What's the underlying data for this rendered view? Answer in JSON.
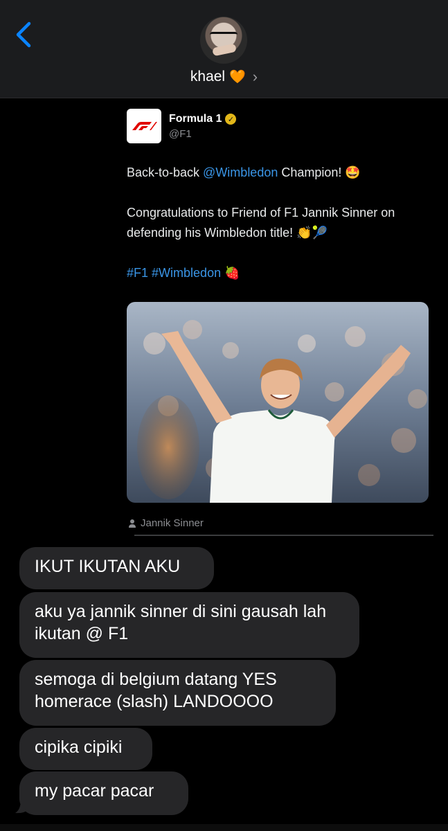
{
  "header": {
    "contact_name": "khael",
    "heart": "🧡",
    "chevron": "›"
  },
  "tweet": {
    "name": "Formula 1",
    "handle": "@F1",
    "line1_prefix": "Back-to-back ",
    "line1_link": "@Wimbledon",
    "line1_suffix": " Champion! 🤩",
    "line2": "Congratulations to Friend of F1 Jannik Sinner on defending his Wimbledon title! 👏🎾",
    "hashtag1": "#F1",
    "hashtag2": "#Wimbledon",
    "hashtag_emoji": "🍓",
    "photo_tag": "Jannik Sinner"
  },
  "messages": [
    "IKUT IKUTAN AKU",
    "aku ya jannik sinner di sini gausah lah ikutan @ F1",
    "semoga di belgium datang YES homerace (slash) LANDOOOO",
    "cipika cipiki",
    "my pacar pacar"
  ],
  "colors": {
    "header_bg": "#1b1c1e",
    "accent_blue": "#0a84ff",
    "link_blue": "#3a95e6",
    "bubble_bg": "#262628",
    "f1_red": "#e10600",
    "verified_gold": "#e2b719"
  },
  "icons": {
    "back": "chevron-left-icon",
    "verified": "verified-badge-icon",
    "person": "person-icon"
  }
}
